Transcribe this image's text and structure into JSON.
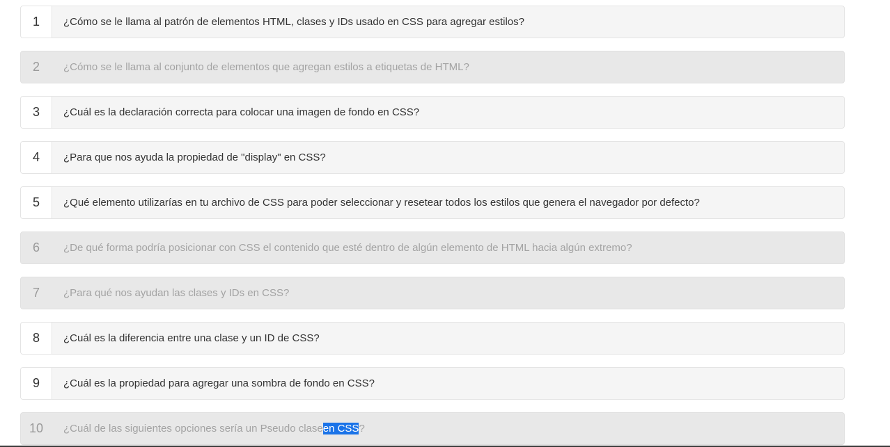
{
  "questions": [
    {
      "number": "1",
      "text": "¿Cómo se le llama al patrón de elementos HTML, clases y IDs usado en CSS para agregar estilos?",
      "state": "active"
    },
    {
      "number": "2",
      "text": "¿Cómo se le llama al conjunto de elementos que agregan estilos a etiquetas de HTML?",
      "state": "disabled"
    },
    {
      "number": "3",
      "text": "¿Cuál es la declaración correcta para colocar una imagen de fondo en CSS?",
      "state": "active"
    },
    {
      "number": "4",
      "text": "¿Para que nos ayuda la propiedad de \"display\" en CSS?",
      "state": "active"
    },
    {
      "number": "5",
      "text": "¿Qué elemento utilizarías en tu archivo de CSS para poder seleccionar y resetear todos los estilos que genera el navegador por defecto?",
      "state": "active"
    },
    {
      "number": "6",
      "text": "¿De qué forma podría posicionar con CSS el contenido que esté dentro de algún elemento de HTML hacia algún extremo?",
      "state": "disabled"
    },
    {
      "number": "7",
      "text": "¿Para qué nos ayudan las clases y IDs en CSS?",
      "state": "disabled"
    },
    {
      "number": "8",
      "text": "¿Cuál es la diferencia entre una clase y un ID de CSS?",
      "state": "active"
    },
    {
      "number": "9",
      "text": "¿Cuál es la propiedad para agregar una sombra de fondo en CSS?",
      "state": "active"
    },
    {
      "number": "10",
      "text_before": "¿Cuál de las siguientes opciones sería un Pseudo clase ",
      "text_selected": "en CSS",
      "text_after": "?",
      "state": "disabled"
    }
  ],
  "colors": {
    "row_active_bg": "#f5f5f5",
    "row_disabled_bg": "#e8e8e8",
    "text_active": "#333333",
    "text_disabled": "#a3a3a3",
    "selection": "#1a73e8"
  }
}
